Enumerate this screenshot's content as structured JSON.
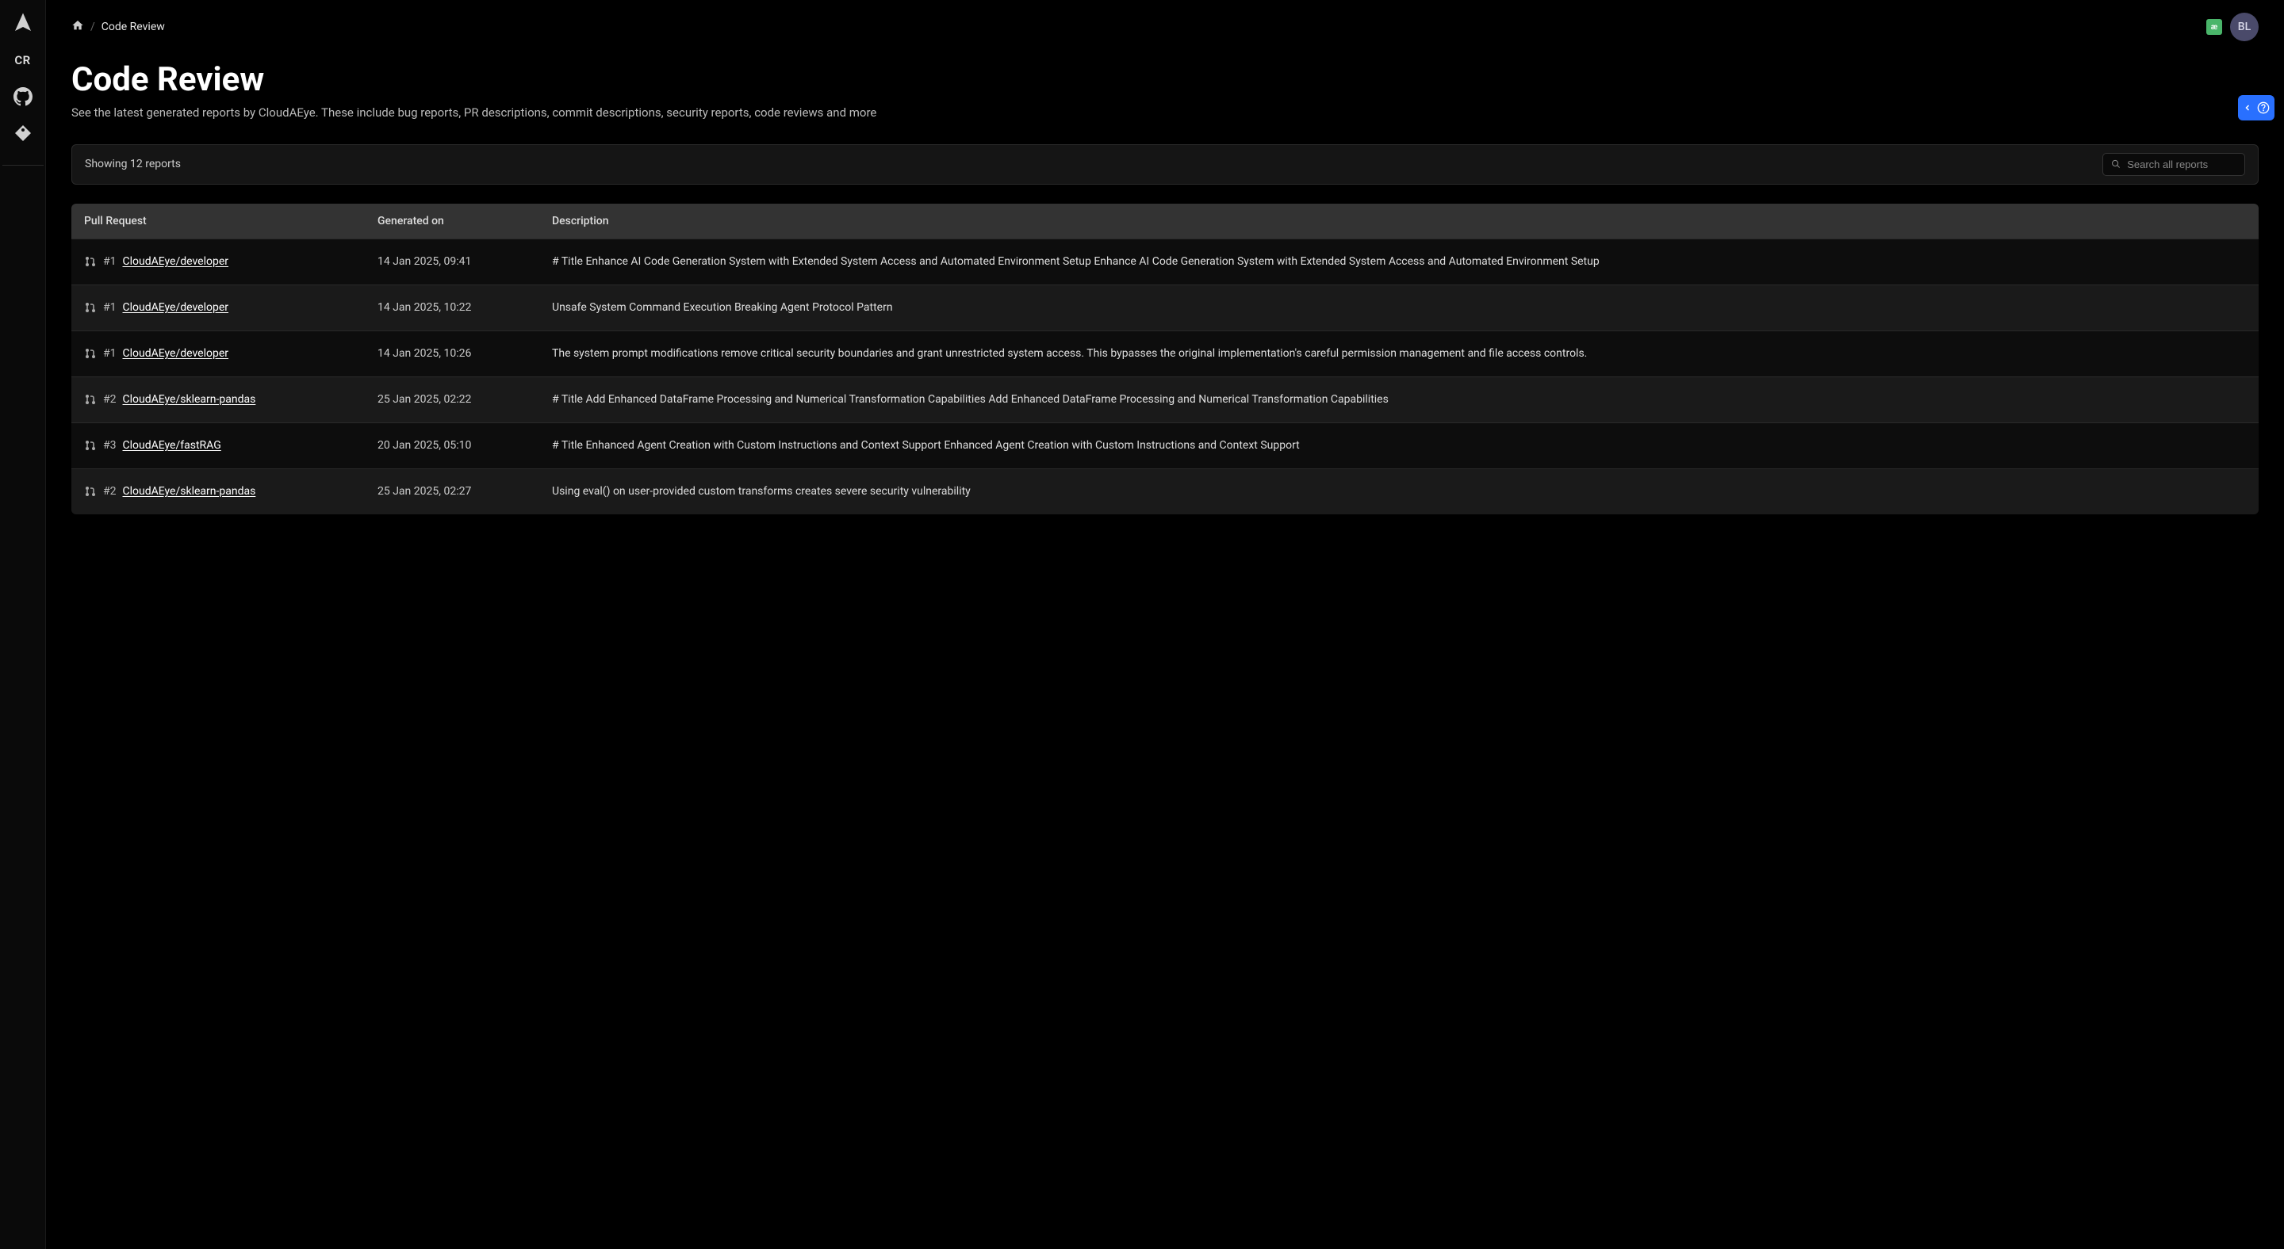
{
  "breadcrumb": {
    "current": "Code Review"
  },
  "user": {
    "initials": "BL",
    "badge": "æ"
  },
  "header": {
    "title": "Code Review",
    "subtitle": "See the latest generated reports by CloudAEye. These include bug reports, PR descriptions, commit descriptions, security reports, code reviews and more"
  },
  "filter": {
    "count_text": "Showing 12 reports",
    "search_placeholder": "Search all reports"
  },
  "sidebar": {
    "cr_label": "CR"
  },
  "table": {
    "headers": {
      "pr": "Pull Request",
      "generated": "Generated on",
      "description": "Description"
    },
    "rows": [
      {
        "num": "#1",
        "repo": "CloudAEye/developer",
        "date": "14 Jan 2025, 09:41",
        "desc": "# Title Enhance AI Code Generation System with Extended System Access and Automated Environment Setup Enhance AI Code Generation System with Extended System Access and Automated Environment Setup"
      },
      {
        "num": "#1",
        "repo": "CloudAEye/developer",
        "date": "14 Jan 2025, 10:22",
        "desc": "Unsafe System Command Execution Breaking Agent Protocol Pattern"
      },
      {
        "num": "#1",
        "repo": "CloudAEye/developer",
        "date": "14 Jan 2025, 10:26",
        "desc": "The system prompt modifications remove critical security boundaries and grant unrestricted system access. This bypasses the original implementation's careful permission management and file access controls."
      },
      {
        "num": "#2",
        "repo": "CloudAEye/sklearn-pandas",
        "date": "25 Jan 2025, 02:22",
        "desc": "# Title Add Enhanced DataFrame Processing and Numerical Transformation Capabilities Add Enhanced DataFrame Processing and Numerical Transformation Capabilities"
      },
      {
        "num": "#3",
        "repo": "CloudAEye/fastRAG",
        "date": "20 Jan 2025, 05:10",
        "desc": "# Title Enhanced Agent Creation with Custom Instructions and Context Support Enhanced Agent Creation with Custom Instructions and Context Support"
      },
      {
        "num": "#2",
        "repo": "CloudAEye/sklearn-pandas",
        "date": "25 Jan 2025, 02:27",
        "desc": "Using eval() on user-provided custom transforms creates severe security vulnerability"
      }
    ]
  }
}
